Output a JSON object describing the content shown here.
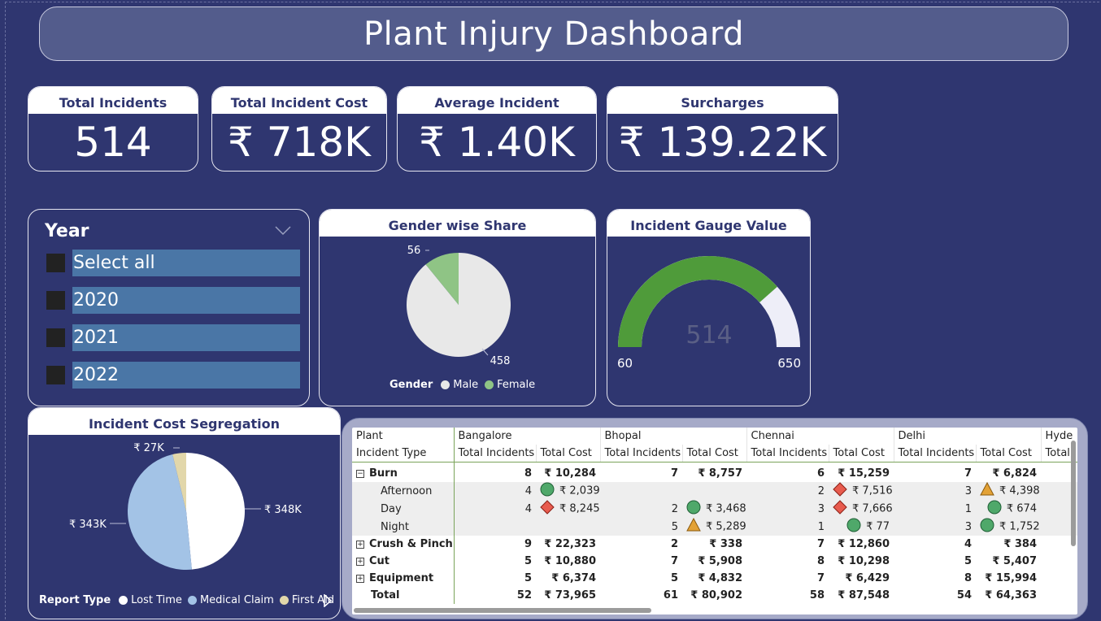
{
  "title": "Plant Injury Dashboard",
  "kpis": [
    {
      "label": "Total Incidents",
      "value": "514"
    },
    {
      "label": "Total Incident Cost",
      "value": "₹ 718K"
    },
    {
      "label": "Average Incident",
      "value": "₹ 1.40K"
    },
    {
      "label": "Surcharges",
      "value": "₹ 139.22K"
    }
  ],
  "slicer": {
    "title": "Year",
    "items": [
      "Select all",
      "2020",
      "2021",
      "2022"
    ]
  },
  "gender": {
    "title": "Gender wise Share",
    "legend_title": "Gender",
    "male_label": "Male",
    "female_label": "Female",
    "male_value": "458",
    "female_value": "56",
    "male_color": "#e8e8e8",
    "female_color": "#8fc485"
  },
  "gauge": {
    "title": "Incident Gauge Value",
    "value": "514",
    "min": "60",
    "max": "650",
    "fill_color": "#4f9b3a",
    "track_color": "#eeeef8"
  },
  "cost": {
    "title": "Incident Cost Segregation",
    "legend_title": "Report Type",
    "lost_label": "Lost Time",
    "medical_label": "Medical Claim",
    "first_aid_label": "First Aid",
    "lost_value": "₹ 348K",
    "medical_value": "₹ 343K",
    "first_aid_value": "₹ 27K",
    "lost_color": "#ffffff",
    "medical_color": "#a3c3e6",
    "first_aid_color": "#e2d7aa"
  },
  "chart_data": [
    {
      "type": "pie",
      "title": "Gender wise Share",
      "legend_title": "Gender",
      "categories": [
        "Male",
        "Female"
      ],
      "values": [
        458,
        56
      ]
    },
    {
      "type": "pie",
      "title": "Incident Cost Segregation",
      "legend_title": "Report Type",
      "categories": [
        "Lost Time",
        "Medical Claim",
        "First Aid"
      ],
      "values": [
        348,
        343,
        27
      ],
      "value_labels": [
        "₹ 348K",
        "₹ 343K",
        "₹ 27K"
      ]
    },
    {
      "type": "gauge",
      "title": "Incident Gauge Value",
      "value": 514,
      "min": 60,
      "max": 650
    }
  ],
  "matrix": {
    "row_header_1": "Plant",
    "row_header_2": "Incident Type",
    "plants": [
      "Bangalore",
      "Bhopal",
      "Chennai",
      "Delhi",
      "Hyde"
    ],
    "col_incidents": "Total Incidents",
    "col_cost": "Total Cost",
    "col_trunc": "Total",
    "rows": [
      {
        "label": "Burn",
        "kind": "group",
        "expander": "⊟",
        "cells": [
          "8",
          "₹ 10,284",
          "7",
          "₹ 8,757",
          "6",
          "₹ 15,259",
          "7",
          "₹ 6,824"
        ],
        "icons": [
          "",
          "",
          "",
          ""
        ]
      },
      {
        "label": "Afternoon",
        "kind": "sub",
        "cells": [
          "4",
          "₹ 2,039",
          "",
          "",
          "2",
          "₹ 7,516",
          "3",
          "₹ 4,398"
        ],
        "icons": [
          "circle",
          "",
          "diamond",
          "triangle"
        ]
      },
      {
        "label": "Day",
        "kind": "sub",
        "cells": [
          "4",
          "₹ 8,245",
          "2",
          "₹ 3,468",
          "3",
          "₹ 7,666",
          "1",
          "₹ 674"
        ],
        "icons": [
          "diamond",
          "circle",
          "diamond",
          "circle"
        ]
      },
      {
        "label": "Night",
        "kind": "sub",
        "cells": [
          "",
          "",
          "5",
          "₹ 5,289",
          "1",
          "₹ 77",
          "3",
          "₹ 1,752"
        ],
        "icons": [
          "",
          "triangle",
          "circle",
          "circle"
        ]
      },
      {
        "label": "Crush & Pinch",
        "kind": "group",
        "expander": "⊞",
        "cells": [
          "9",
          "₹ 22,323",
          "2",
          "₹ 338",
          "7",
          "₹ 12,860",
          "4",
          "₹ 384"
        ],
        "icons": [
          "",
          "",
          "",
          ""
        ]
      },
      {
        "label": "Cut",
        "kind": "group",
        "expander": "⊞",
        "cells": [
          "5",
          "₹ 10,880",
          "7",
          "₹ 5,908",
          "8",
          "₹ 10,298",
          "5",
          "₹ 5,407"
        ],
        "icons": [
          "",
          "",
          "",
          ""
        ]
      },
      {
        "label": "Equipment",
        "kind": "group",
        "expander": "⊞",
        "cells": [
          "5",
          "₹ 6,374",
          "5",
          "₹ 4,832",
          "7",
          "₹ 6,429",
          "8",
          "₹ 15,994"
        ],
        "icons": [
          "",
          "",
          "",
          ""
        ]
      },
      {
        "label": "Total",
        "kind": "total",
        "cells": [
          "52",
          "₹ 73,965",
          "61",
          "₹ 80,902",
          "58",
          "₹ 87,548",
          "54",
          "₹ 64,363"
        ],
        "icons": [
          "",
          "",
          "",
          ""
        ]
      }
    ]
  }
}
